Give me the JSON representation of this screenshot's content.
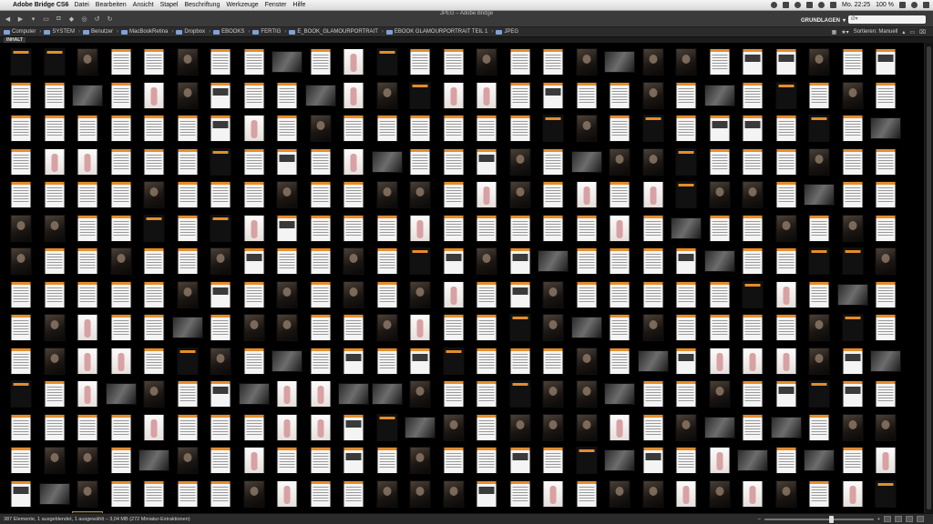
{
  "menubar": {
    "app_name": "Adobe Bridge CS6",
    "items": [
      "Datei",
      "Bearbeiten",
      "Ansicht",
      "Stapel",
      "Beschriftung",
      "Werkzeuge",
      "Fenster",
      "Hilfe"
    ],
    "clock": "Mo. 22:25",
    "battery": "100 %"
  },
  "window": {
    "title": "JPEG – Adobe Bridge",
    "workspace": "GRUNDLAGEN",
    "search_placeholder": "Ø▾"
  },
  "breadcrumbs": [
    "Computer",
    "SYSTEM",
    "Benutzer",
    "MacBookRetina",
    "Dropbox",
    "EBOOKS",
    "FERTIG",
    "E_BOOK_GLAMOURPORTRAIT",
    "EBOOK GLAMOURPORTRAIT TEIL 1",
    "JPEG"
  ],
  "sort_label": "Sortieren: Manuell",
  "panel": {
    "tab_label": "INHALT"
  },
  "status": {
    "text": "387 Elemente, 1 ausgeblendet, 1 ausgewählt – 3,04 MB (272 Miniatur-Extraktionen)"
  },
  "thumbnail_size_fraction": 0.62,
  "grid": {
    "columns": 27,
    "total": 387,
    "selected_index": 380
  },
  "colors": {
    "accent": "#e58d2a",
    "background": "#000000",
    "frame": "#3a3a3a"
  }
}
